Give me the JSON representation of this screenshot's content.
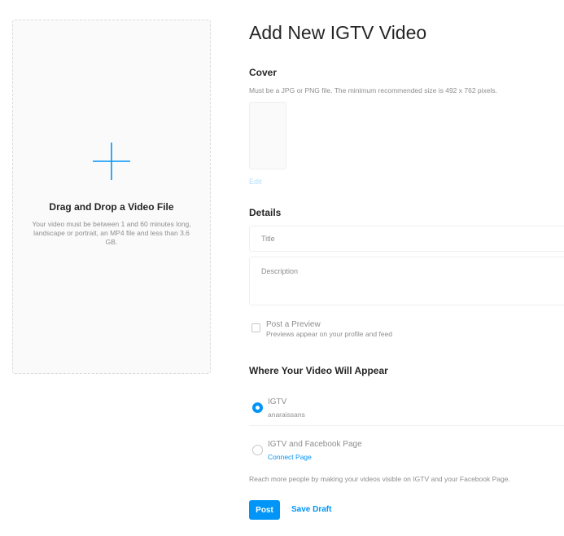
{
  "upload": {
    "title": "Drag and Drop a Video File",
    "description": "Your video must be between 1 and 60 minutes long, landscape or portrait, an MP4 file and less than 3.6 GB.",
    "icon": "plus-icon"
  },
  "page_title": "Add New IGTV Video",
  "cover": {
    "heading": "Cover",
    "hint": "Must be a JPG or PNG file. The minimum recommended size is 492 x 762 pixels.",
    "edit_label": "Edit"
  },
  "details": {
    "heading": "Details",
    "title_placeholder": "Title",
    "title_value": "",
    "description_placeholder": "Description",
    "description_value": ""
  },
  "preview": {
    "label": "Post a Preview",
    "sublabel": "Previews appear on your profile and feed",
    "checked": false
  },
  "placement": {
    "heading": "Where Your Video Will Appear",
    "options": [
      {
        "label": "IGTV",
        "sublabel": "anaraissans",
        "selected": true
      },
      {
        "label": "IGTV and Facebook Page",
        "sublabel": "Connect Page",
        "selected": false
      }
    ],
    "reach_text": "Reach more people by making your videos visible on IGTV and your Facebook Page."
  },
  "actions": {
    "post_label": "Post",
    "draft_label": "Save Draft"
  },
  "colors": {
    "accent": "#0095f6",
    "text": "#262626",
    "muted": "#8e8e8e",
    "border": "#dbdbdb"
  }
}
